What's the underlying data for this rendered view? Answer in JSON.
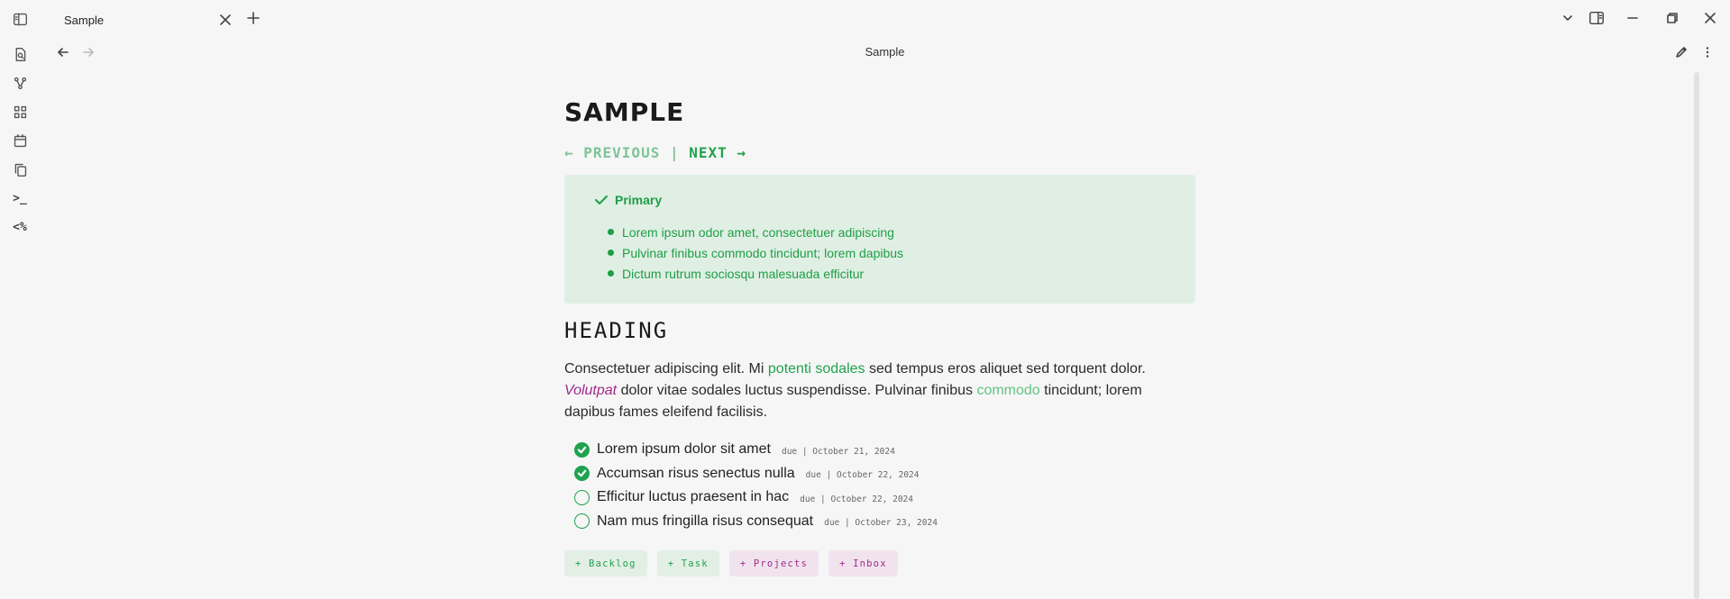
{
  "tab": {
    "title": "Sample"
  },
  "view": {
    "title": "Sample"
  },
  "ribbon": {
    "items": [
      {
        "icon": "sidebar-toggle-icon"
      },
      {
        "icon": "file-search-icon"
      },
      {
        "icon": "graph-icon"
      },
      {
        "icon": "grid-icon"
      },
      {
        "icon": "calendar-icon"
      },
      {
        "icon": "copy-icon"
      },
      {
        "icon": "terminal-icon",
        "label": ">_"
      },
      {
        "icon": "templater-icon",
        "label": "<%"
      }
    ]
  },
  "note": {
    "heading": "SAMPLE",
    "nav": {
      "prev": "← PREVIOUS",
      "sep": " | ",
      "next": "NEXT →"
    },
    "callout": {
      "title": "Primary",
      "items": [
        "Lorem ipsum odor amet, consectetuer adipiscing",
        "Pulvinar finibus commodo tincidunt; lorem dapibus",
        "Dictum rutrum sociosqu malesuada efficitur"
      ]
    },
    "section_heading": "HEADING",
    "paragraph": {
      "p1": "Consectetuer adipiscing elit. Mi ",
      "link1": "potenti sodales",
      "p2": " sed tempus eros aliquet sed torquent dolor. ",
      "em": "Volutpat",
      "p3": " dolor vitae sodales luctus suspendisse. Pulvinar finibus ",
      "link2": "commodo",
      "p4": " tincidunt; lorem dapibus fames eleifend facilisis."
    },
    "tasks": [
      {
        "text": "Lorem ipsum dolor sit amet",
        "due": "due | October 21, 2024",
        "done": true
      },
      {
        "text": "Accumsan risus senectus nulla",
        "due": "due | October 22, 2024",
        "done": true
      },
      {
        "text": "Efficitur luctus praesent in hac",
        "due": "due | October 22, 2024",
        "done": false
      },
      {
        "text": "Nam mus fringilla risus consequat",
        "due": "due | October 23, 2024",
        "done": false
      }
    ],
    "buttons": [
      {
        "label": "+ Backlog",
        "color": "green"
      },
      {
        "label": "+ Task",
        "color": "green"
      },
      {
        "label": "+ Projects",
        "color": "pink"
      },
      {
        "label": "+ Inbox",
        "color": "pink"
      }
    ]
  },
  "colors": {
    "accent_green": "#1fa34e",
    "accent_pink": "#a0298a",
    "callout_bg": "#e0efe3"
  }
}
